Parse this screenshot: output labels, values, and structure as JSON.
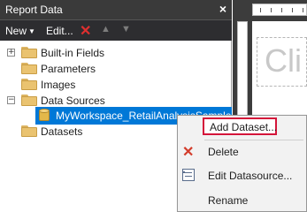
{
  "panel": {
    "title": "Report Data",
    "close_glyph": "×"
  },
  "toolbar": {
    "new_label": "New",
    "edit_label": "Edit...",
    "delete_icon": "delete-x-icon",
    "move_up_icon": "arrow-up-icon",
    "move_down_icon": "arrow-down-icon"
  },
  "tree": {
    "items": [
      {
        "label": "Built-in Fields",
        "expander": "+",
        "icon": "folder-icon"
      },
      {
        "label": "Parameters",
        "expander": "",
        "icon": "folder-icon"
      },
      {
        "label": "Images",
        "expander": "",
        "icon": "folder-icon"
      },
      {
        "label": "Data Sources",
        "expander": "−",
        "icon": "folder-icon"
      },
      {
        "label": "MyWorkspace_RetailAnalysisSample",
        "expander": "",
        "icon": "database-icon",
        "selected": true
      },
      {
        "label": "Datasets",
        "expander": "",
        "icon": "folder-icon"
      }
    ]
  },
  "designer": {
    "textbox_text": "Cli"
  },
  "context_menu": {
    "items": [
      {
        "label": "Add Dataset...",
        "icon": "",
        "highlighted": true
      },
      {
        "label": "Delete",
        "icon": "delete-x-icon"
      },
      {
        "label": "Edit Datasource...",
        "icon": "edit-properties-icon"
      },
      {
        "label": "Rename",
        "icon": ""
      }
    ]
  },
  "colors": {
    "selection": "#0078d7",
    "highlight_border": "#d4153a",
    "title_bar": "#3a3a3a"
  }
}
